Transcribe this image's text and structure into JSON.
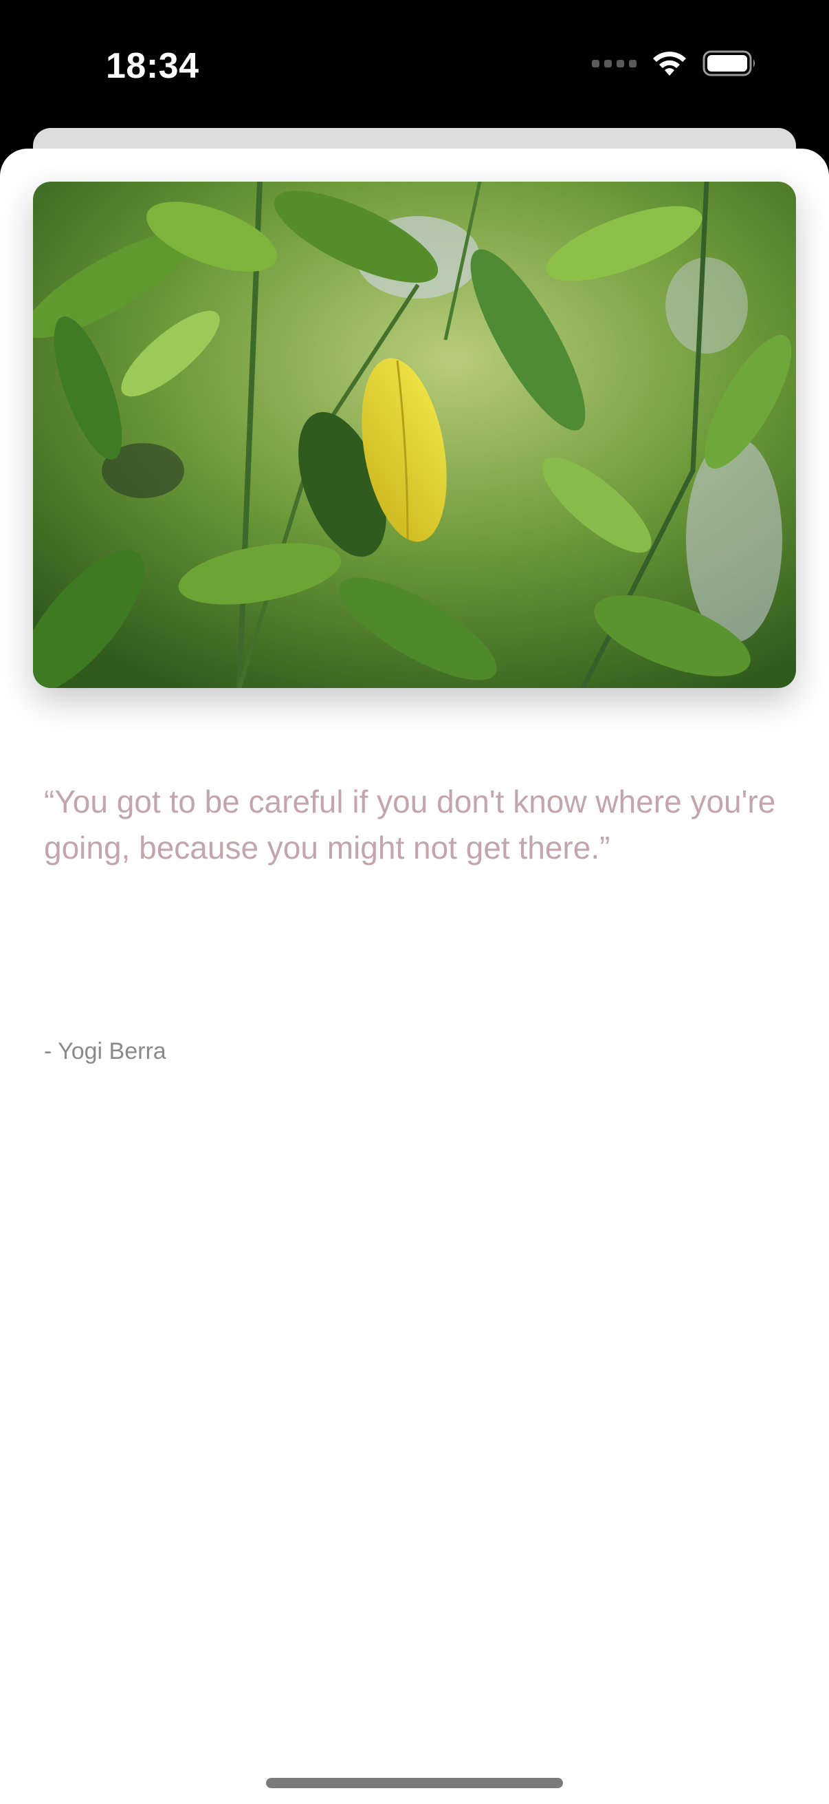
{
  "status_bar": {
    "time": "18:34"
  },
  "icons": {
    "signal": "cellular-signal-icon",
    "wifi": "wifi-icon",
    "battery": "battery-icon"
  },
  "photo": {
    "subject": "sunlit citrus leaves with one yellow leaf"
  },
  "quote": {
    "text": "“You got to be careful if you don't know where you're going, because you might not get there.”",
    "author": "- Yogi Berra"
  },
  "colors": {
    "quote_text": "#c3a5ab",
    "author_text": "#8a8a8a",
    "background": "#ffffff"
  }
}
